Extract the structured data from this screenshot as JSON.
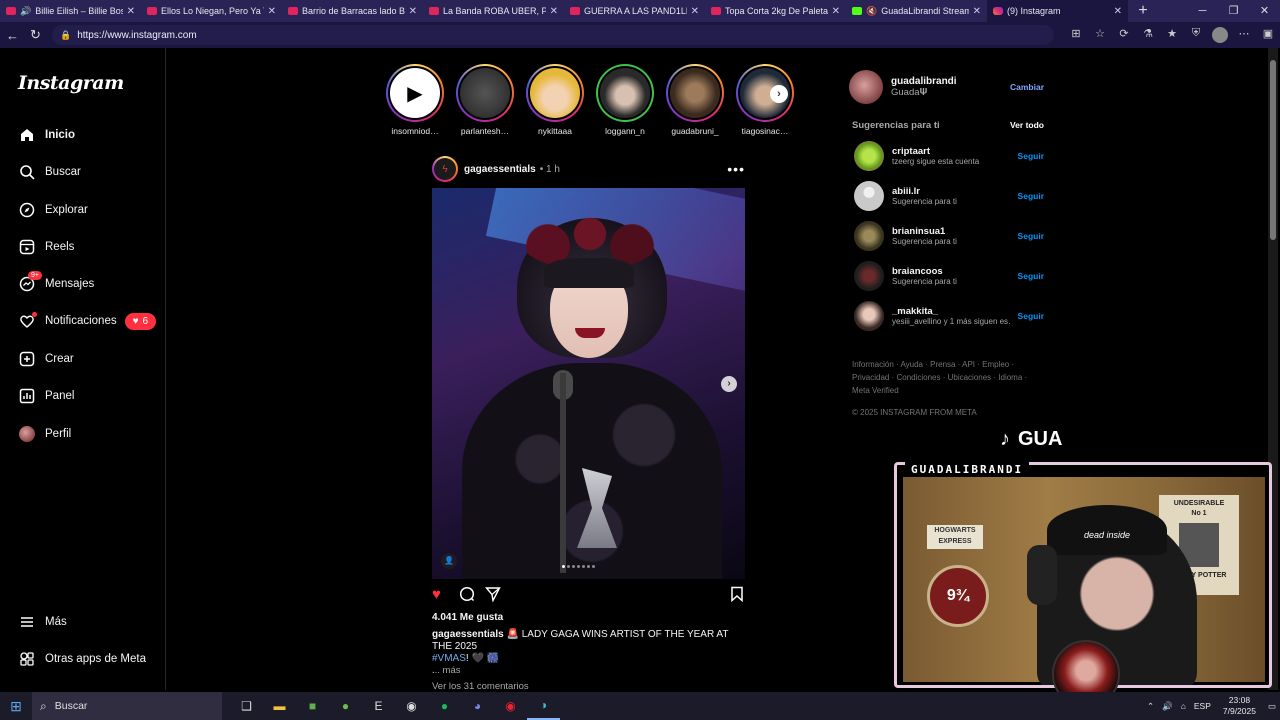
{
  "browser": {
    "tabs": [
      {
        "title": "Billie Eilish – Billie Boss…",
        "muted": true
      },
      {
        "title": "Ellos Lo Niegan, Pero Ya To…"
      },
      {
        "title": "Barrio de Barracas lado B : …"
      },
      {
        "title": "La Banda ROBA UBER, PELE…"
      },
      {
        "title": "GUERRA A LAS PAND1LLAS …"
      },
      {
        "title": "Topa Corta 2kg De Paleta M…"
      },
      {
        "title": "GuadaLibrandi Stream",
        "muted": true
      },
      {
        "title": "(9) Instagram"
      }
    ],
    "new_tab": "+",
    "url": "https://www.instagram.com"
  },
  "instagram": {
    "logo": "Instagram",
    "nav": [
      {
        "label": "Inicio",
        "icon": "home-icon"
      },
      {
        "label": "Buscar",
        "icon": "search-icon"
      },
      {
        "label": "Explorar",
        "icon": "compass-icon"
      },
      {
        "label": "Reels",
        "icon": "reels-icon"
      },
      {
        "label": "Mensajes",
        "icon": "messenger-icon",
        "badge": "9+"
      },
      {
        "label": "Notificaciones",
        "icon": "heart-icon",
        "badge": "6"
      },
      {
        "label": "Crear",
        "icon": "plus-square-icon"
      },
      {
        "label": "Panel",
        "icon": "chart-icon"
      },
      {
        "label": "Perfil",
        "icon": "avatar"
      }
    ],
    "nav_bottom": [
      {
        "label": "Más",
        "icon": "menu-icon"
      },
      {
        "label": "Otras apps de Meta",
        "icon": "meta-apps-icon"
      }
    ],
    "stories": [
      {
        "name": "insomniod…"
      },
      {
        "name": "parlantesh…"
      },
      {
        "name": "nykittaaa"
      },
      {
        "name": "loggann_n"
      },
      {
        "name": "guadabruni_"
      },
      {
        "name": "tiagosinac…"
      }
    ],
    "post": {
      "user": "gagaessentials",
      "time": "1 h",
      "likes": "4.041 Me gusta",
      "caption_user": "gagaessentials",
      "caption_text": "🚨 LADY GAGA WINS ARTIST OF THE YEAR AT THE 2025",
      "caption_tag": "#VMAS",
      "caption_tail": "! 🖤 🎆",
      "caption_dot": ".",
      "more": "... más",
      "comments": "Ver los 31 comentarios"
    },
    "me": {
      "username": "guadalibrandi",
      "name": "Guada𝚿",
      "switch": "Cambiar"
    },
    "suggestions_title": "Sugerencias para ti",
    "see_all": "Ver todo",
    "suggestions": [
      {
        "user": "criptaart",
        "desc": "tzeerg sigue esta cuenta",
        "follow": "Seguir"
      },
      {
        "user": "abiii.lr",
        "desc": "Sugerencia para ti",
        "follow": "Seguir"
      },
      {
        "user": "brianinsua1",
        "desc": "Sugerencia para ti",
        "follow": "Seguir"
      },
      {
        "user": "braiancoos",
        "desc": "Sugerencia para ti",
        "follow": "Seguir"
      },
      {
        "user": "_makkita_",
        "desc": "yesiii_avellino y 1 más siguen es…",
        "follow": "Seguir"
      }
    ],
    "footer_line1": "Información · Ayuda · Prensa · API · Empleo ·",
    "footer_line2": "Privacidad · Condiciones · Ubicaciones · Idioma ·",
    "footer_line3": "Meta Verified",
    "copyright": "© 2025 INSTAGRAM FROM META"
  },
  "overlay": {
    "tiktok_text": "GUA",
    "cam_label": "GUADALIBRANDI",
    "poster_hogwarts": "HOGWARTS EXPRESS",
    "platform": "9¾",
    "wanted_title": "UNDESIRABLE",
    "wanted_no": "No 1",
    "wanted_name": "HARRY POTTER",
    "beanie_text": "dead inside"
  },
  "taskbar": {
    "search": "Buscar",
    "lang": "ESP",
    "time": "23:08",
    "date": "7/9/2025"
  }
}
